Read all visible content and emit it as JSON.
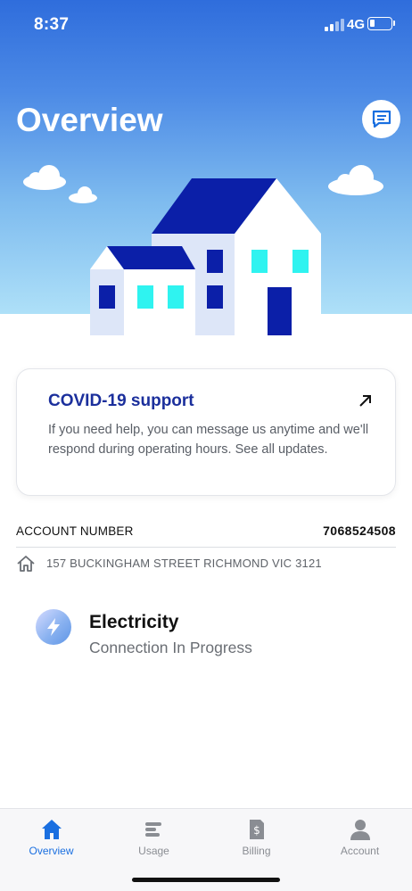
{
  "status_bar": {
    "time": "8:37",
    "network": "4G",
    "battery_fraction": 0.25
  },
  "header": {
    "title": "Overview"
  },
  "covid_card": {
    "title": "COVID-19 support",
    "body": "If you need help, you can message us anytime and we'll respond during operating hours. See all updates."
  },
  "account": {
    "label": "ACCOUNT NUMBER",
    "number": "7068524508",
    "address": "157 BUCKINGHAM STREET RICHMOND VIC 3121"
  },
  "service": {
    "title": "Electricity",
    "status": "Connection In Progress"
  },
  "tabs": [
    {
      "label": "Overview",
      "icon": "home-icon",
      "active": true
    },
    {
      "label": "Usage",
      "icon": "usage-icon",
      "active": false
    },
    {
      "label": "Billing",
      "icon": "billing-icon",
      "active": false
    },
    {
      "label": "Account",
      "icon": "account-icon",
      "active": false
    }
  ],
  "colors": {
    "accent": "#1a6fe0",
    "card_title": "#1b2f9c",
    "house_roof": "#0b1fa8",
    "house_wall": "#dde6f8",
    "window_lit": "#2ff3f0"
  }
}
